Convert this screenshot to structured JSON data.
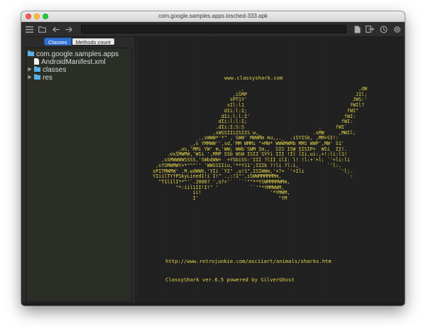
{
  "window": {
    "title": "com.google.samples.apps.iosched-333.apk"
  },
  "toolbar": {
    "search_value": "",
    "icons_left": [
      "menu-icon",
      "folder-open-icon",
      "back-arrow-icon",
      "forward-arrow-icon"
    ],
    "icons_right": [
      "document-icon",
      "export-icon",
      "history-icon",
      "settings-icon"
    ]
  },
  "tabs": [
    {
      "label": "Classes",
      "active": true
    },
    {
      "label": "Methods count",
      "active": false
    }
  ],
  "tree": {
    "root": "com.google.samples.apps",
    "children": [
      {
        "label": "AndroidManifest.xml",
        "type": "file"
      },
      {
        "label": "classes",
        "type": "folder"
      },
      {
        "label": "res",
        "type": "folder"
      }
    ]
  },
  "content": {
    "site": "www.classyshark.com",
    "ascii_art": "                                   _,                                        ,dW\n                                 ,iSMP                                      JIl;\n                                sPT1Y'                                     JWS:'\n                               sIl:l1                                     fWIl?\n                              dIi:l:I;                                   fWI\"\n                             dIi:l:l:I'                                 fWI:\n                            dIi:l:l:I;                                 fWI:\n                           .dIi:I:S:S                          .     fWI`\n                          ,sWSSIIiISIIS w,_                  .sMW     ,MWIl;\n                    _.,sWWW*'*\" , SWW' MWWMm mu,,._  .iSYISb, ,MM+SI!:\n                  _,s YMMWW'',sd,'MM WMMi \"+MW* WWWMWMb MMS WWP',MW' S1'\n             _,os,'MMi YW' m,'WW; WWb`SWM Im,,  SIS ISW SISIP+  WSi  II!.\n          .osSMWMW,'WSi ',MMP SSb WSW ISII`SYYi III !Il lIi,ui:,+!:li:l1!\n        ,sSMWWWWSSSS,'SWbdWW+  +YSbiSS:'III ?lII ilI: l! !l:+'+l; `'+li:li\n      ,sYSMWMWY+*\"\"\"'' 'WWSSIIiu,'**Y11';IIIb ?!li ?l:i,          `'l:.\n     sPITMWMW' .M.wdWWb,'YIi `YI\" ,u!1\",ISIWWm,'+?+ `'+Ili            `'l:.\n     YIiilTYfPSkyLinedI!i`I!\" .,:!1\"',iSWWMMMMMMm,                       `:\n       \"T1l1lI**\"'`.2006? ',o?+'`  ``'\"\"**YSWMMMMWMm,\n             \"*:iil1II!I!\" '           ``'\"*YMMWWM,\n                   ii!                        '*YMWM,\n                   I'                            \"YM",
    "url": "http://www.retrojunkie.com/asciiart/animals/sharks.htm",
    "footer": "ClassyShark ver.6.5 powered by SilverGhost"
  },
  "colors": {
    "ascii_text": "#e2d24a",
    "active_tab": "#2f6fd4",
    "folder": "#5bb0e8",
    "panel_bg": "#1f1f1f"
  }
}
